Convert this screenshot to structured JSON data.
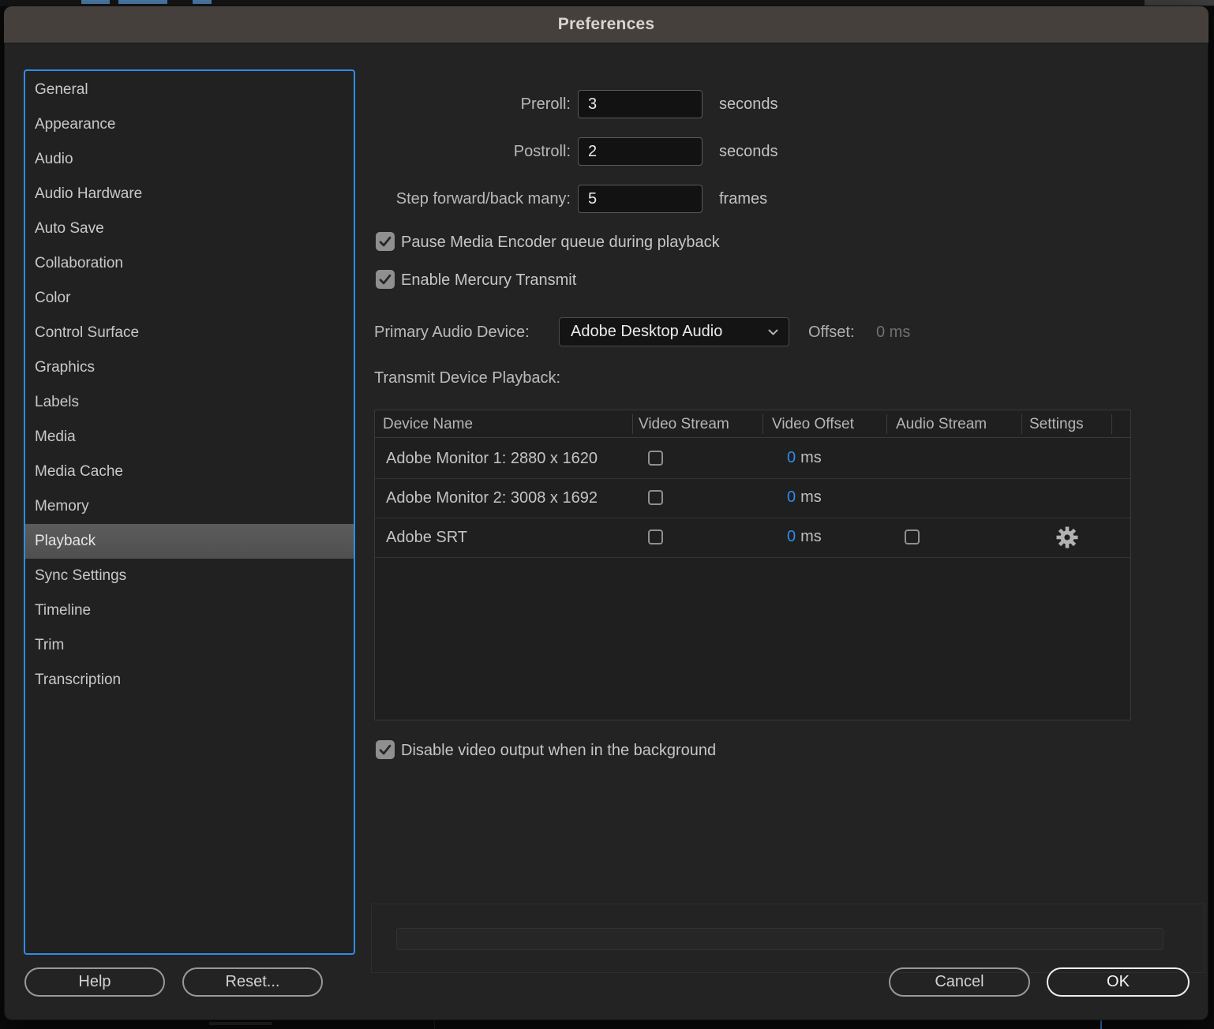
{
  "window": {
    "title": "Preferences"
  },
  "sidebar": {
    "items": [
      {
        "label": "General",
        "selected": false
      },
      {
        "label": "Appearance",
        "selected": false
      },
      {
        "label": "Audio",
        "selected": false
      },
      {
        "label": "Audio Hardware",
        "selected": false
      },
      {
        "label": "Auto Save",
        "selected": false
      },
      {
        "label": "Collaboration",
        "selected": false
      },
      {
        "label": "Color",
        "selected": false
      },
      {
        "label": "Control Surface",
        "selected": false
      },
      {
        "label": "Graphics",
        "selected": false
      },
      {
        "label": "Labels",
        "selected": false
      },
      {
        "label": "Media",
        "selected": false
      },
      {
        "label": "Media Cache",
        "selected": false
      },
      {
        "label": "Memory",
        "selected": false
      },
      {
        "label": "Playback",
        "selected": true
      },
      {
        "label": "Sync Settings",
        "selected": false
      },
      {
        "label": "Timeline",
        "selected": false
      },
      {
        "label": "Trim",
        "selected": false
      },
      {
        "label": "Transcription",
        "selected": false
      }
    ]
  },
  "fields": {
    "preroll": {
      "label": "Preroll:",
      "value": "3",
      "unit": "seconds"
    },
    "postroll": {
      "label": "Postroll:",
      "value": "2",
      "unit": "seconds"
    },
    "step_many": {
      "label": "Step forward/back many:",
      "value": "5",
      "unit": "frames"
    }
  },
  "toggles": {
    "pause_encoder": {
      "label": "Pause Media Encoder queue during playback",
      "checked": true
    },
    "mercury_transmit": {
      "label": "Enable Mercury Transmit",
      "checked": true
    },
    "disable_video_bg": {
      "label": "Disable video output when in the background",
      "checked": true
    }
  },
  "primary_audio": {
    "label": "Primary Audio Device:",
    "selected": "Adobe Desktop Audio",
    "offset_label": "Offset:",
    "offset_value": "0 ms"
  },
  "transmit": {
    "section_label": "Transmit Device Playback:",
    "columns": [
      "Device Name",
      "Video Stream",
      "Video Offset",
      "Audio Stream",
      "Settings"
    ],
    "rows": [
      {
        "device": "Adobe Monitor 1: 2880 x 1620",
        "video_stream_checked": false,
        "video_offset_num": "0",
        "video_offset_unit": "ms"
      },
      {
        "device": "Adobe Monitor 2: 3008 x 1692",
        "video_stream_checked": false,
        "video_offset_num": "0",
        "video_offset_unit": "ms"
      },
      {
        "device": "Adobe SRT",
        "video_stream_checked": false,
        "video_offset_num": "0",
        "video_offset_unit": "ms",
        "audio_stream_checked": false,
        "has_settings_gear": true
      }
    ]
  },
  "buttons": {
    "help": "Help",
    "reset": "Reset...",
    "cancel": "Cancel",
    "ok": "OK"
  },
  "colors": {
    "accent_blue": "#2E8CEB",
    "titlebar": "#46403C",
    "dialog_bg": "#232323",
    "offset_zero_blue": "#2E8CEB",
    "selected_item_bg": "#555555"
  }
}
